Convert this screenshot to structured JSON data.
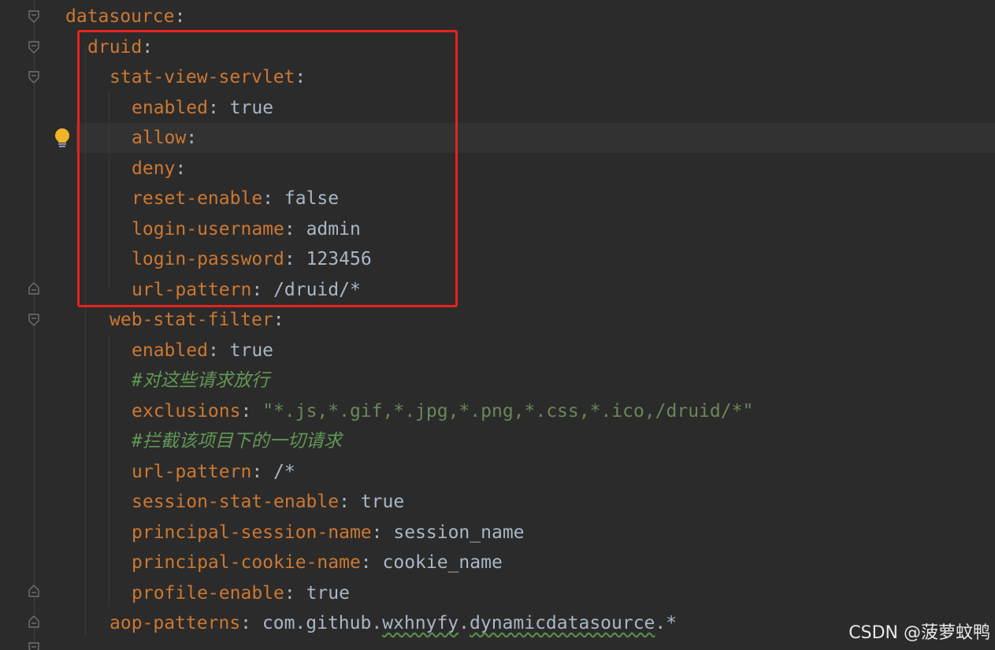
{
  "code": {
    "lines": [
      {
        "key": "datasource",
        "colon": ":",
        "value": ""
      },
      {
        "key": "druid",
        "colon": ":",
        "value": ""
      },
      {
        "key": "stat-view-servlet",
        "colon": ":",
        "value": ""
      },
      {
        "key": "enabled",
        "colon": ": ",
        "value": "true"
      },
      {
        "key": "allow",
        "colon": ":",
        "value": ""
      },
      {
        "key": "deny",
        "colon": ":",
        "value": ""
      },
      {
        "key": "reset-enable",
        "colon": ": ",
        "value": "false"
      },
      {
        "key": "login-username",
        "colon": ": ",
        "value": "admin"
      },
      {
        "key": "login-password",
        "colon": ": ",
        "value": "123456"
      },
      {
        "key": "url-pattern",
        "colon": ": ",
        "value": "/druid/*"
      },
      {
        "key": "web-stat-filter",
        "colon": ":",
        "value": ""
      },
      {
        "key": "enabled",
        "colon": ": ",
        "value": "true"
      },
      {
        "comment": "#对这些请求放行"
      },
      {
        "key": "exclusions",
        "colon": ": ",
        "string": "\"*.js,*.gif,*.jpg,*.png,*.css,*.ico,/druid/*\""
      },
      {
        "comment": "#拦截该项目下的一切请求"
      },
      {
        "key": "url-pattern",
        "colon": ": ",
        "value": "/*"
      },
      {
        "key": "session-stat-enable",
        "colon": ": ",
        "value": "true"
      },
      {
        "key": "principal-session-name",
        "colon": ": ",
        "value": "session_name"
      },
      {
        "key": "principal-cookie-name",
        "colon": ": ",
        "value": "cookie_name"
      },
      {
        "key": "profile-enable",
        "colon": ": ",
        "value": "true"
      },
      {
        "key": "aop-patterns",
        "colon": ": ",
        "value_parts": [
          "com.github.",
          "wxhnyfy",
          ".",
          "dynamicdatasource",
          ".*"
        ]
      }
    ]
  },
  "watermark": "CSDN @菠萝蚊鸭",
  "colors": {
    "background": "#2b2b2b",
    "key": "#cc7832",
    "value": "#a9b7c6",
    "string": "#6a8759",
    "comment": "#629755",
    "highlight_box": "#e5231f",
    "bulb": "#f0b429"
  },
  "icons": [
    "fold-marker-icon",
    "lightbulb-icon"
  ]
}
